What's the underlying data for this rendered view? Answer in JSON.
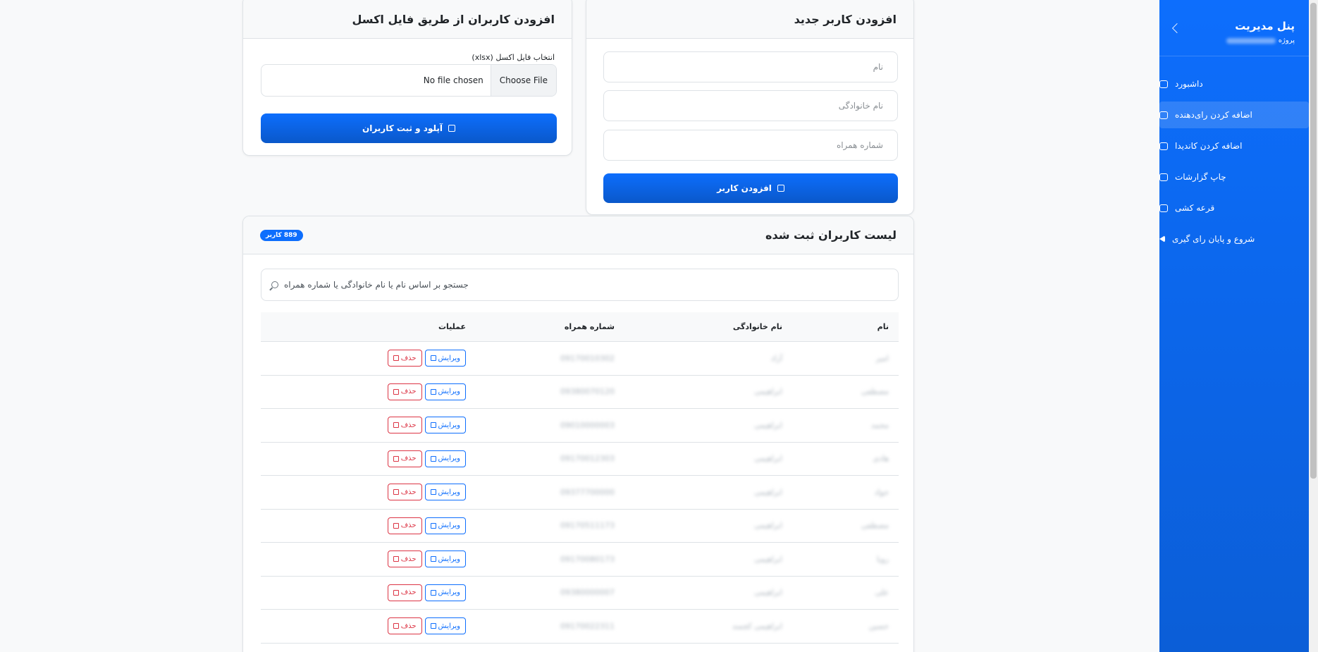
{
  "sidebar": {
    "title": "پنل مدیریت",
    "subtitle": "پروژه",
    "items": [
      {
        "label": "داشبورد",
        "icon": "speedometer-icon",
        "active": false
      },
      {
        "label": "اضافه کردن رای‌دهنده",
        "icon": "users-icon",
        "active": true
      },
      {
        "label": "اضافه کردن کاندیدا",
        "icon": "person-badge-icon",
        "active": false
      },
      {
        "label": "چاپ گزارشات",
        "icon": "bar-chart-icon",
        "active": false
      },
      {
        "label": "قرعه کشی",
        "icon": "shuffle-icon",
        "active": false
      },
      {
        "label": "شروع و پایان رای گیری",
        "icon": "skip-start-icon",
        "active": false
      }
    ]
  },
  "add_user": {
    "title": "افزودن کاربر جدید",
    "name_placeholder": "نام",
    "family_placeholder": "نام خانوادگی",
    "phone_placeholder": "شماره همراه",
    "submit_label": "افزودن کاربر"
  },
  "excel": {
    "title": "افزودن کاربران از طریق فایل اکسل",
    "file_label": "انتخاب فایل اکسل (xlsx)",
    "choose_label": "Choose File",
    "no_file_label": "No file chosen",
    "upload_label": "آپلود و ثبت کاربران"
  },
  "list": {
    "title": "لیست کاربران ثبت شده",
    "badge": "889 کاربر",
    "search_placeholder": "جستجو بر اساس نام یا نام خانوادگی یا شماره همراه",
    "columns": [
      "نام",
      "نام خانوادگی",
      "شماره همراه",
      "عملیات"
    ],
    "edit_label": "ویرایش",
    "delete_label": "حذف",
    "rows": [
      {
        "name": "امیر",
        "family": "آزاد",
        "phone": "09170010302"
      },
      {
        "name": "مصطفی",
        "family": "ابراهیمی",
        "phone": "09380070120"
      },
      {
        "name": "محمد",
        "family": "ابراهیمی",
        "phone": "09010000003"
      },
      {
        "name": "هادی",
        "family": "ابراهیمی",
        "phone": "09170012303"
      },
      {
        "name": "جواد",
        "family": "ابراهیمی",
        "phone": "09377700000"
      },
      {
        "name": "مصطفی",
        "family": "ابراهیمی",
        "phone": "09170511173"
      },
      {
        "name": "رویا",
        "family": "ابراهیمی",
        "phone": "09170080173"
      },
      {
        "name": "علی",
        "family": "ابراهیمی",
        "phone": "09380000007"
      },
      {
        "name": "حسین",
        "family": "ابراهیمی کجمند",
        "phone": "09170022311"
      }
    ]
  }
}
